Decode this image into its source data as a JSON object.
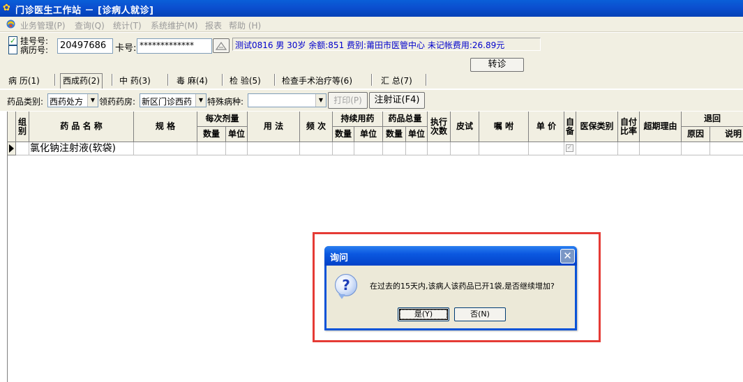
{
  "window": {
    "title": "门诊医生工作站 － [诊病人就诊]"
  },
  "menu": [
    "业务管理(P)",
    "查询(Q)",
    "统计(T)",
    "系统维护(M)",
    "报表",
    "帮助 (H)"
  ],
  "patient": {
    "registration_label": "挂号号:",
    "registration_checked": true,
    "record_label": "病历号:",
    "record_checked": false,
    "number_value": "20497686",
    "card_label": "卡号:",
    "card_value": "*************",
    "info_text": "测试0816 男 30岁 余额:851 费别:莆田市医管中心 未记帐费用:26.89元",
    "transfer_button": "转诊"
  },
  "tabs": [
    "病 历(1)",
    "西成药(2)",
    "中 药(3)",
    "毒 麻(4)",
    "检 验(5)",
    "检查手术治疗等(6)",
    "汇 总(7)"
  ],
  "active_tab": "西成药(2)",
  "drug_toolbar": {
    "category_label": "药品类别:",
    "category_value": "西药处方",
    "pharmacy_label": "领药药房:",
    "pharmacy_value": "新区门诊西药",
    "disease_label": "特殊病种:",
    "disease_value": "",
    "print_button": "打印(P)",
    "injection_button": "注射证(F4)"
  },
  "grid": {
    "headers": {
      "group": "组别",
      "drug_name": "药 品 名 称",
      "spec": "规 格",
      "per_dose": "每次剂量",
      "per_dose_qty": "数量",
      "per_dose_unit": "单位",
      "usage": "用 法",
      "frequency": "频 次",
      "continuous": "持续用药",
      "continuous_qty": "数量",
      "continuous_unit": "单位",
      "total": "药品总量",
      "total_qty": "数量",
      "total_unit": "单位",
      "exec_times": "执行次数",
      "skin_test": "皮试",
      "instructions": "嘱 咐",
      "unit_price": "单 价",
      "self_prepared": "自备",
      "insurance_type": "医保类别",
      "self_pay_ratio": "自付比率",
      "overdue_reason": "超期理由",
      "return": "退回",
      "return_reason": "原因",
      "return_note": "说明"
    },
    "rows": [
      {
        "drug_name": "氯化钠注射液(软袋)",
        "self_prepared_checked": true
      }
    ]
  },
  "dialog": {
    "title": "询问",
    "message": "在过去的15天内,该病人该药品已开1袋,是否继续增加?",
    "yes_button": "是(Y)",
    "no_button": "否(N)"
  },
  "colors": {
    "titlebar": "#0b4fcf",
    "highlight_border": "#e53b35",
    "info_text": "#0000cc"
  }
}
